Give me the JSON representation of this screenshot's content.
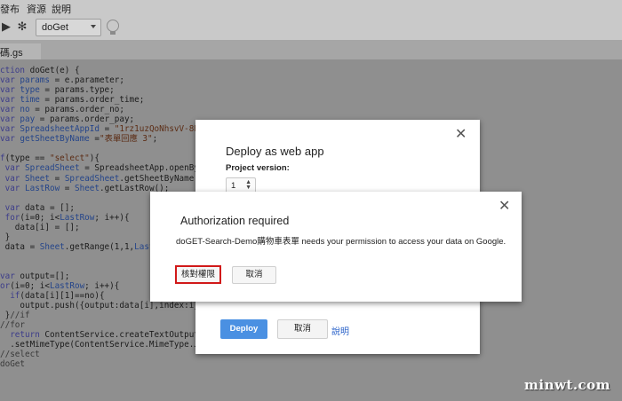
{
  "menu": [
    "發布",
    "資源",
    "說明"
  ],
  "toolbar": {
    "function_select": "doGet"
  },
  "tab": {
    "file_label": "碼.gs"
  },
  "code_lines": [
    [
      [
        "k",
        "ction"
      ],
      [
        "t",
        " doGet(e) {"
      ]
    ],
    [
      [
        "k",
        "var"
      ],
      [
        "t",
        " "
      ],
      [
        "v",
        "params"
      ],
      [
        "t",
        " = e.parameter;"
      ]
    ],
    [
      [
        "k",
        "var"
      ],
      [
        "t",
        " "
      ],
      [
        "v",
        "type"
      ],
      [
        "t",
        " = params.type;"
      ]
    ],
    [
      [
        "k",
        "var"
      ],
      [
        "t",
        " "
      ],
      [
        "v",
        "time"
      ],
      [
        "t",
        " = params.order_time;"
      ]
    ],
    [
      [
        "k",
        "var"
      ],
      [
        "t",
        " "
      ],
      [
        "v",
        "no"
      ],
      [
        "t",
        " = params.order_no;"
      ]
    ],
    [
      [
        "k",
        "var"
      ],
      [
        "t",
        " "
      ],
      [
        "v",
        "pay"
      ],
      [
        "t",
        " = params.order_pay;"
      ]
    ],
    [
      [
        "k",
        "var"
      ],
      [
        "t",
        " "
      ],
      [
        "v",
        "SpreadsheetAppId"
      ],
      [
        "t",
        " = "
      ],
      [
        "s",
        "\"1rz1uzQoNhsvV-8Ez7Eg"
      ]
    ],
    [
      [
        "k",
        "var"
      ],
      [
        "t",
        " "
      ],
      [
        "v",
        "getSheetByName"
      ],
      [
        "t",
        " ="
      ],
      [
        "s",
        "\"表單回應 3\""
      ],
      [
        "t",
        ";"
      ]
    ],
    [
      [
        "t",
        ""
      ]
    ],
    [
      [
        "k",
        "f"
      ],
      [
        "t",
        "(type == "
      ],
      [
        "s",
        "\"select\""
      ],
      [
        "t",
        "){"
      ]
    ],
    [
      [
        "t",
        " "
      ],
      [
        "k",
        "var"
      ],
      [
        "t",
        " "
      ],
      [
        "v",
        "SpreadSheet"
      ],
      [
        "t",
        " = SpreadsheetApp.openById(S"
      ]
    ],
    [
      [
        "t",
        " "
      ],
      [
        "k",
        "var"
      ],
      [
        "t",
        " "
      ],
      [
        "v",
        "Sheet"
      ],
      [
        "t",
        " = "
      ],
      [
        "v",
        "SpreadSheet"
      ],
      [
        "t",
        ".getSheetByName(getS"
      ]
    ],
    [
      [
        "t",
        " "
      ],
      [
        "k",
        "var"
      ],
      [
        "t",
        " "
      ],
      [
        "v",
        "LastRow"
      ],
      [
        "t",
        " = "
      ],
      [
        "v",
        "Sheet"
      ],
      [
        "t",
        ".getLastRow();"
      ]
    ],
    [
      [
        "t",
        ""
      ]
    ],
    [
      [
        "t",
        " "
      ],
      [
        "k",
        "var"
      ],
      [
        "t",
        " data = [];"
      ]
    ],
    [
      [
        "t",
        " "
      ],
      [
        "k",
        "for"
      ],
      [
        "t",
        "(i=0; i<"
      ],
      [
        "v",
        "LastRow"
      ],
      [
        "t",
        "; i++){"
      ]
    ],
    [
      [
        "t",
        "   data[i] = [];"
      ]
    ],
    [
      [
        "t",
        " }"
      ]
    ],
    [
      [
        "t",
        " data = "
      ],
      [
        "v",
        "Sheet"
      ],
      [
        "t",
        ".getRange(1,1,"
      ],
      [
        "v",
        "LastRow"
      ]
    ],
    [
      [
        "t",
        ""
      ]
    ],
    [
      [
        "t",
        ""
      ]
    ],
    [
      [
        "k",
        "var"
      ],
      [
        "t",
        " output=[];"
      ]
    ],
    [
      [
        "k",
        "or"
      ],
      [
        "t",
        "(i=0; i<"
      ],
      [
        "v",
        "LastRow"
      ],
      [
        "t",
        "; i++){"
      ]
    ],
    [
      [
        "t",
        "  "
      ],
      [
        "k",
        "if"
      ],
      [
        "t",
        "(data[i][1]==no){"
      ]
    ],
    [
      [
        "t",
        "    output.push({output:data[i],index:i});"
      ]
    ],
    [
      [
        "t",
        " }"
      ],
      [
        "c",
        "//if"
      ]
    ],
    [
      [
        "c",
        "//for"
      ]
    ],
    [
      [
        "t",
        "  "
      ],
      [
        "k",
        "return"
      ],
      [
        "t",
        " ContentService.createTextOutput(JSO"
      ]
    ],
    [
      [
        "t",
        "  .setMimeType(ContentService.MimeType.JSON)"
      ]
    ],
    [
      [
        "c",
        "//select"
      ]
    ],
    [
      [
        "c",
        "doGet"
      ]
    ]
  ],
  "deploy_dialog": {
    "title": "Deploy as web app",
    "version_label": "Project version:",
    "version_value": "1",
    "deploy_button": "Deploy",
    "cancel_button": "取消",
    "help_link": "說明"
  },
  "auth_dialog": {
    "title": "Authorization required",
    "message": "doGET-Search-Demo購物車表單 needs your permission to access your data on Google.",
    "review_button": "核對權限",
    "cancel_button": "取消"
  },
  "watermark": "minwt.com",
  "colors": {
    "accent_blue": "#4a90e2",
    "highlight_red": "#d11919",
    "overlay_gray": "#8f8f8f"
  }
}
